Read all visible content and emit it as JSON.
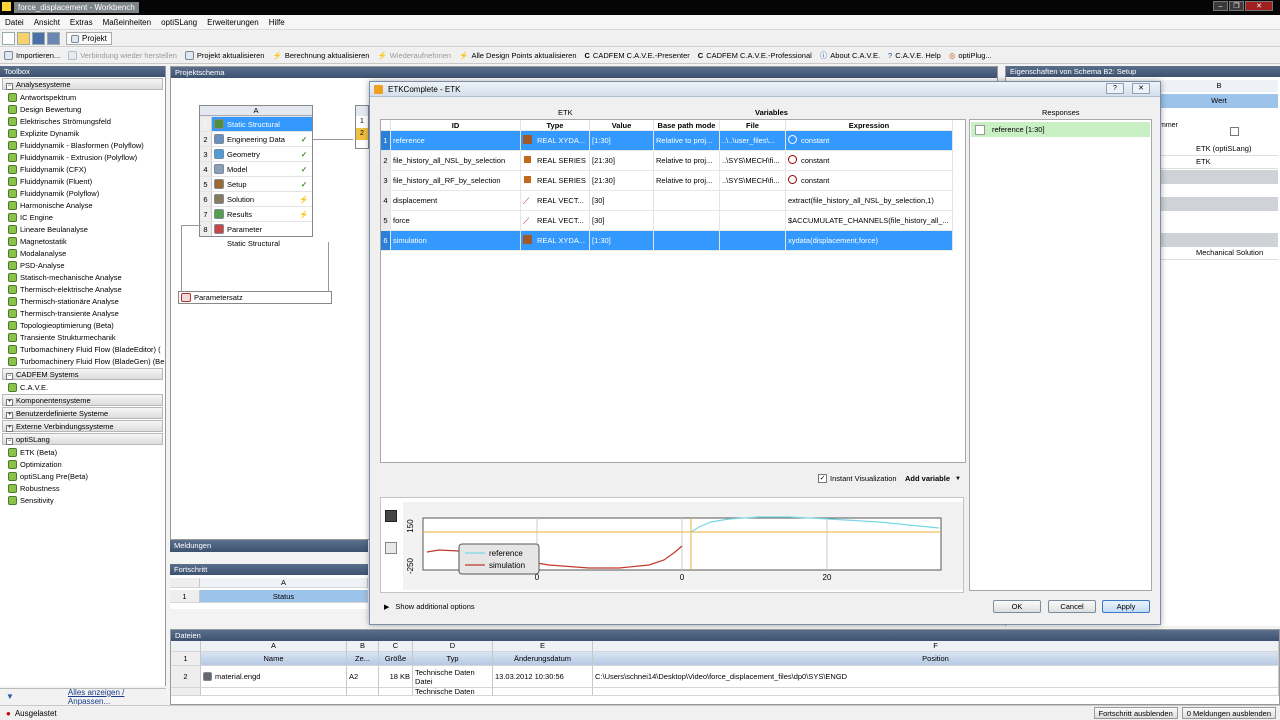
{
  "window": {
    "title": "force_displacement - Workbench"
  },
  "menu": [
    "Datei",
    "Ansicht",
    "Extras",
    "Maßeinheiten",
    "optiSLang",
    "Erweiterungen",
    "Hilfe"
  ],
  "toolbar1": {
    "project_label": "Projekt"
  },
  "toolbar2": {
    "items": [
      {
        "label": "Importieren...",
        "disabled": false
      },
      {
        "label": "Verbindung wieder herstellen",
        "disabled": true
      },
      {
        "label": "Projekt aktualisieren",
        "disabled": false
      },
      {
        "label": "Berechnung aktualisieren",
        "disabled": false
      },
      {
        "label": "Wiederaufnehmen",
        "disabled": true
      },
      {
        "label": "Alle Design Points aktualisieren",
        "disabled": false
      },
      {
        "label": "CADFEM C.A.V.E.-Presenter",
        "disabled": false
      },
      {
        "label": "CADFEM C.A.V.E.-Professional",
        "disabled": false
      },
      {
        "label": "About C.A.V.E.",
        "disabled": false
      },
      {
        "label": "C.A.V.E. Help",
        "disabled": false
      },
      {
        "label": "optiPlug...",
        "disabled": false
      }
    ]
  },
  "toolbox": {
    "title": "Toolbox",
    "sections": [
      {
        "label": "Analysesysteme",
        "expanded": true,
        "items": [
          "Antwortspektrum",
          "Design Bewertung",
          "Elektrisches Strömungsfeld",
          "Explizite Dynamik",
          "Fluiddynamik - Blasformen (Polyflow)",
          "Fluiddynamik - Extrusion (Polyflow)",
          "Fluiddynamik (CFX)",
          "Fluiddynamik (Fluent)",
          "Fluiddynamik (Polyflow)",
          "Harmonische Analyse",
          "IC Engine",
          "Lineare Beulanalyse",
          "Magnetostatik",
          "Modalanalyse",
          "PSD-Analyse",
          "Statisch-mechanische Analyse",
          "Thermisch-elektrische Analyse",
          "Thermisch-stationäre Analyse",
          "Thermisch-transiente Analyse",
          "Topologieoptimierung (Beta)",
          "Transiente Strukturmechanik",
          "Turbomachinery Fluid Flow (BladeEditor) (",
          "Turbomachinery Fluid Flow (BladeGen) (Be"
        ]
      },
      {
        "label": "CADFEM Systems",
        "expanded": true,
        "items": [
          "C.A.V.E."
        ]
      },
      {
        "label": "Komponentensysteme",
        "expanded": false,
        "items": []
      },
      {
        "label": "Benutzerdefinierte Systeme",
        "expanded": false,
        "items": []
      },
      {
        "label": "Externe Verbindungssysteme",
        "expanded": false,
        "items": []
      },
      {
        "label": "optiSLang",
        "expanded": true,
        "items": [
          "ETK (Beta)",
          "Optimization",
          "optiSLang Pre(Beta)",
          "Robustness",
          "Sensitivity"
        ]
      }
    ],
    "footer": "Alles anzeigen / Anpassen..."
  },
  "schema": {
    "title": "Projektschema",
    "system": {
      "col": "A",
      "rows": [
        {
          "n": "1",
          "label": "Static Structural",
          "state": ""
        },
        {
          "n": "2",
          "label": "Engineering Data",
          "state": "✓"
        },
        {
          "n": "3",
          "label": "Geometry",
          "state": "✓"
        },
        {
          "n": "4",
          "label": "Model",
          "state": "✓"
        },
        {
          "n": "5",
          "label": "Setup",
          "state": "✓"
        },
        {
          "n": "6",
          "label": "Solution",
          "state": "⚡"
        },
        {
          "n": "7",
          "label": "Results",
          "state": "⚡"
        },
        {
          "n": "8",
          "label": "Parameter",
          "state": ""
        }
      ],
      "caption": "Static Structural"
    },
    "param_set": "Parametersatz",
    "second_rows": [
      "1",
      "2"
    ]
  },
  "properties": {
    "title": "Eigenschaften von Schema B2: Setup",
    "col_b": "B",
    "wert": "Wert",
    "partial_label": "mmer",
    "values": [
      "ETK (optiSLang)",
      "ETK",
      "Mechanical Solution"
    ]
  },
  "meldungen": {
    "title": "Meldungen"
  },
  "fortschritt": {
    "title": "Fortschritt",
    "col": "A",
    "row": "1",
    "status_hdr": "Status"
  },
  "dateien": {
    "title": "Dateien",
    "cols": [
      "A",
      "B",
      "C",
      "D",
      "E",
      "F"
    ],
    "headers": [
      "Name",
      "Ze...",
      "Größe",
      "Typ",
      "Änderungsdatum",
      "Position"
    ],
    "rows": [
      {
        "n": "2",
        "name": "material.engd",
        "zelle": "A2",
        "size": "18 KB",
        "type": "Technische Daten Datei",
        "date": "13.03.2012 10:30:56",
        "pos": "C:\\Users\\schnei14\\Desktop\\Video\\force_displacement_files\\dp0\\SYS\\ENGD"
      },
      {
        "n": "3",
        "name": "",
        "zelle": "",
        "size": "",
        "type": "Technische Daten",
        "date": "",
        "pos": ""
      }
    ]
  },
  "statusbar": {
    "left": "Ausgelastet",
    "btn1": "Fortschritt ausblenden",
    "btn2": "0 Meldungen ausblenden"
  },
  "dialog": {
    "title": "ETKComplete - ETK",
    "etk_label": "ETK",
    "variables_label": "Variables",
    "responses_label": "Responses",
    "col_headers": [
      "ID",
      "Type",
      "Value",
      "Base path mode",
      "File",
      "Expression"
    ],
    "variables": [
      {
        "n": "1",
        "id": "reference",
        "type": "REAL XYDA...",
        "value": "[1:30]",
        "base": "Relative to proj...",
        "file": "..\\..\\user_files\\...",
        "expr": "constant",
        "icon": "xy",
        "expr_icon": true,
        "selected": true
      },
      {
        "n": "2",
        "id": "file_history_all_NSL_by_selection",
        "type": "REAL SERIES",
        "value": "[21:30]",
        "base": "Relative to proj...",
        "file": "..\\SYS\\MECH\\fi...",
        "expr": "constant",
        "icon": "series",
        "expr_icon": true,
        "selected": false
      },
      {
        "n": "3",
        "id": "file_history_all_RF_by_selection",
        "type": "REAL SERIES",
        "value": "[21:30]",
        "base": "Relative to proj...",
        "file": "..\\SYS\\MECH\\fi...",
        "expr": "constant",
        "icon": "series",
        "expr_icon": true,
        "selected": false
      },
      {
        "n": "4",
        "id": "displacement",
        "type": "REAL VECT...",
        "value": "[30]",
        "base": "",
        "file": "",
        "expr": "extract(file_history_all_NSL_by_selection,1)",
        "icon": "vect",
        "expr_icon": false,
        "selected": false
      },
      {
        "n": "5",
        "id": "force",
        "type": "REAL VECT...",
        "value": "[30]",
        "base": "",
        "file": "",
        "expr": "$ACCUMULATE_CHANNELS(file_history_all_...",
        "icon": "vect",
        "expr_icon": false,
        "selected": false
      },
      {
        "n": "6",
        "id": "simulation",
        "type": "REAL XYDA...",
        "value": "[1:30]",
        "base": "",
        "file": "",
        "expr": "xydata(displacement,force)",
        "icon": "xy",
        "expr_icon": false,
        "selected": true
      }
    ],
    "response": "reference [1:30]",
    "instant_vis": "Instant Visualization",
    "add_variable": "Add variable",
    "show_options": "Show additional options",
    "ok": "OK",
    "cancel": "Cancel",
    "apply": "Apply",
    "help_icon": "?",
    "close_icon": "✕"
  },
  "chart_data": {
    "type": "line",
    "yticks": [
      "150",
      "-250"
    ],
    "xticks": [
      "0",
      "0",
      "20"
    ],
    "legend": [
      "reference",
      "simulation"
    ],
    "series_colors": [
      "#7ad6e4",
      "#c0392b"
    ],
    "vline_color": "#f2b134",
    "hline_color": "#f2b134"
  },
  "colors": {
    "selection": "#3399ff",
    "accent": "#5a6f8c"
  }
}
